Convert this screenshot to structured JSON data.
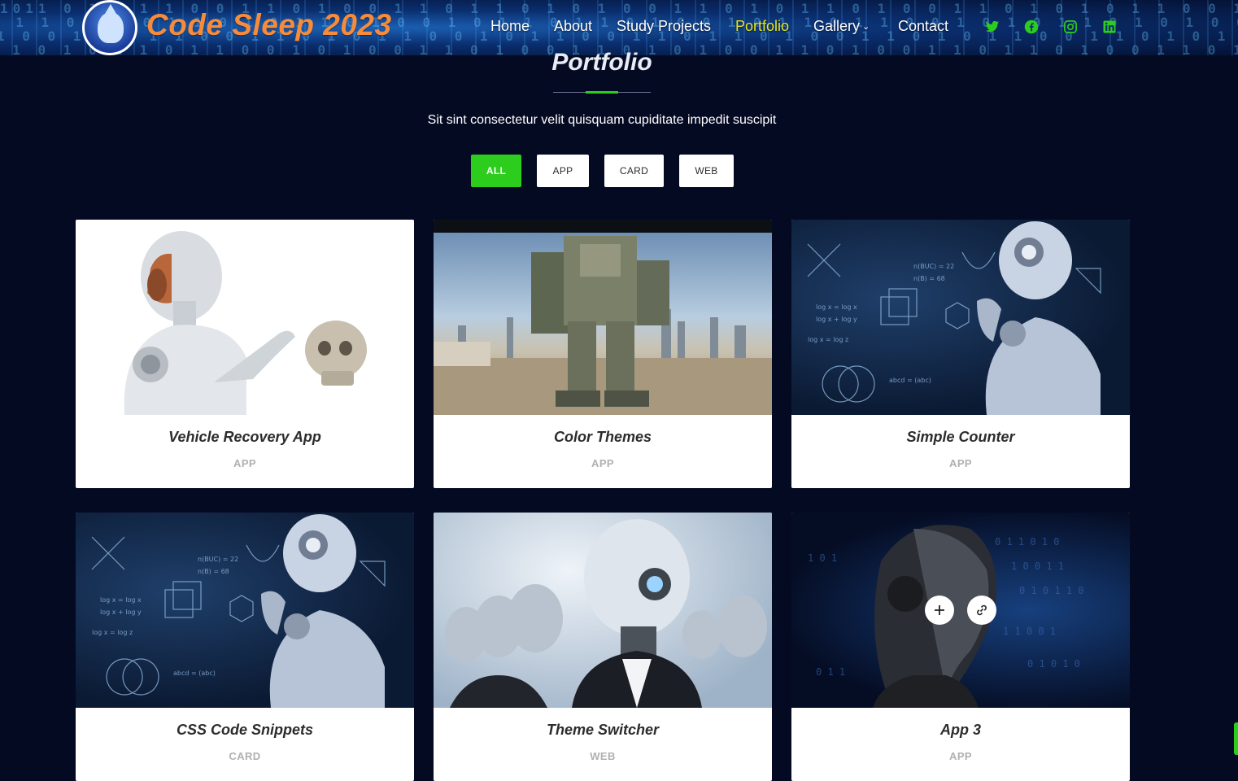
{
  "header": {
    "brand": "Code Sleep 2023",
    "nav": [
      {
        "label": "Home",
        "active": false
      },
      {
        "label": "About",
        "active": false
      },
      {
        "label": "Study Projects",
        "active": false
      },
      {
        "label": "Portfolio",
        "active": true
      },
      {
        "label": "Gallery",
        "active": false,
        "dropdown": true
      },
      {
        "label": "Contact",
        "active": false
      }
    ],
    "social": [
      "twitter-icon",
      "facebook-icon",
      "instagram-icon",
      "linkedin-icon"
    ],
    "social_color": "#2ccd1d",
    "binary_rows": [
      "1011 0 1 0 1 1 0 0 1 1 0 1 0 0 1 1 0 1 1 0 1 0 1 0 0 1 1 0 1 0 1 1 0 1 0 0 1 1 0 1 0 1 0 1 1 0 0 1 0 1 1 0 1 0 1 1 0 1",
      "0 1 1 0 1 0 0 1 1 0 1 0 1 1 0 1 0 0 1 0 1 1 0 1 1 0 1 0 0 1 0 1 1 0 1 1 0 0 1 0 1 0 1 1 0 1 0 1 0 0 1 1 0 1 0 0 1",
      "1 0 0 1 1 0 1 1 0 0 1 1 0 1 0 1 1 0 0 1 0 1 1 0 0 1 1 0 1 1 0 1 0 0 1 1 0 1 0 1 1 0 0 1 1 0 1 0 1 1 0 0 1 0 1 1 0",
      "0 1 0 1 0 1 1 0 1 1 0 0 1 0 1 0 0 1 1 0 1 0 0 1 1 0 1 0 1 0 0 1 1 0 1 0 0 1 1 0 1 1 0 1 0 0 1 1 0 1 0 1 0 1 1 0 1"
    ]
  },
  "section": {
    "title": "Portfolio",
    "subtitle": "Sit sint consectetur velit quisquam cupiditate impedit suscipit",
    "accent_color": "#2ccd1d"
  },
  "filters": [
    {
      "label": "ALL",
      "active": true
    },
    {
      "label": "APP",
      "active": false
    },
    {
      "label": "CARD",
      "active": false
    },
    {
      "label": "WEB",
      "active": false
    }
  ],
  "cards": [
    {
      "title": "Vehicle Recovery App",
      "category": "APP",
      "image": "robot-holding-skull-image"
    },
    {
      "title": "Color Themes",
      "category": "APP",
      "image": "mech-robot-city-image"
    },
    {
      "title": "Simple Counter",
      "category": "APP",
      "image": "thinking-robot-math-image"
    },
    {
      "title": "CSS Code Snippets",
      "category": "CARD",
      "image": "thinking-robot-math-image"
    },
    {
      "title": "Theme Switcher",
      "category": "WEB",
      "image": "robot-crowd-image"
    },
    {
      "title": "App 3",
      "category": "APP",
      "image": "dark-robot-binary-image",
      "hover_icons": [
        "plus-icon",
        "link-icon"
      ]
    }
  ]
}
